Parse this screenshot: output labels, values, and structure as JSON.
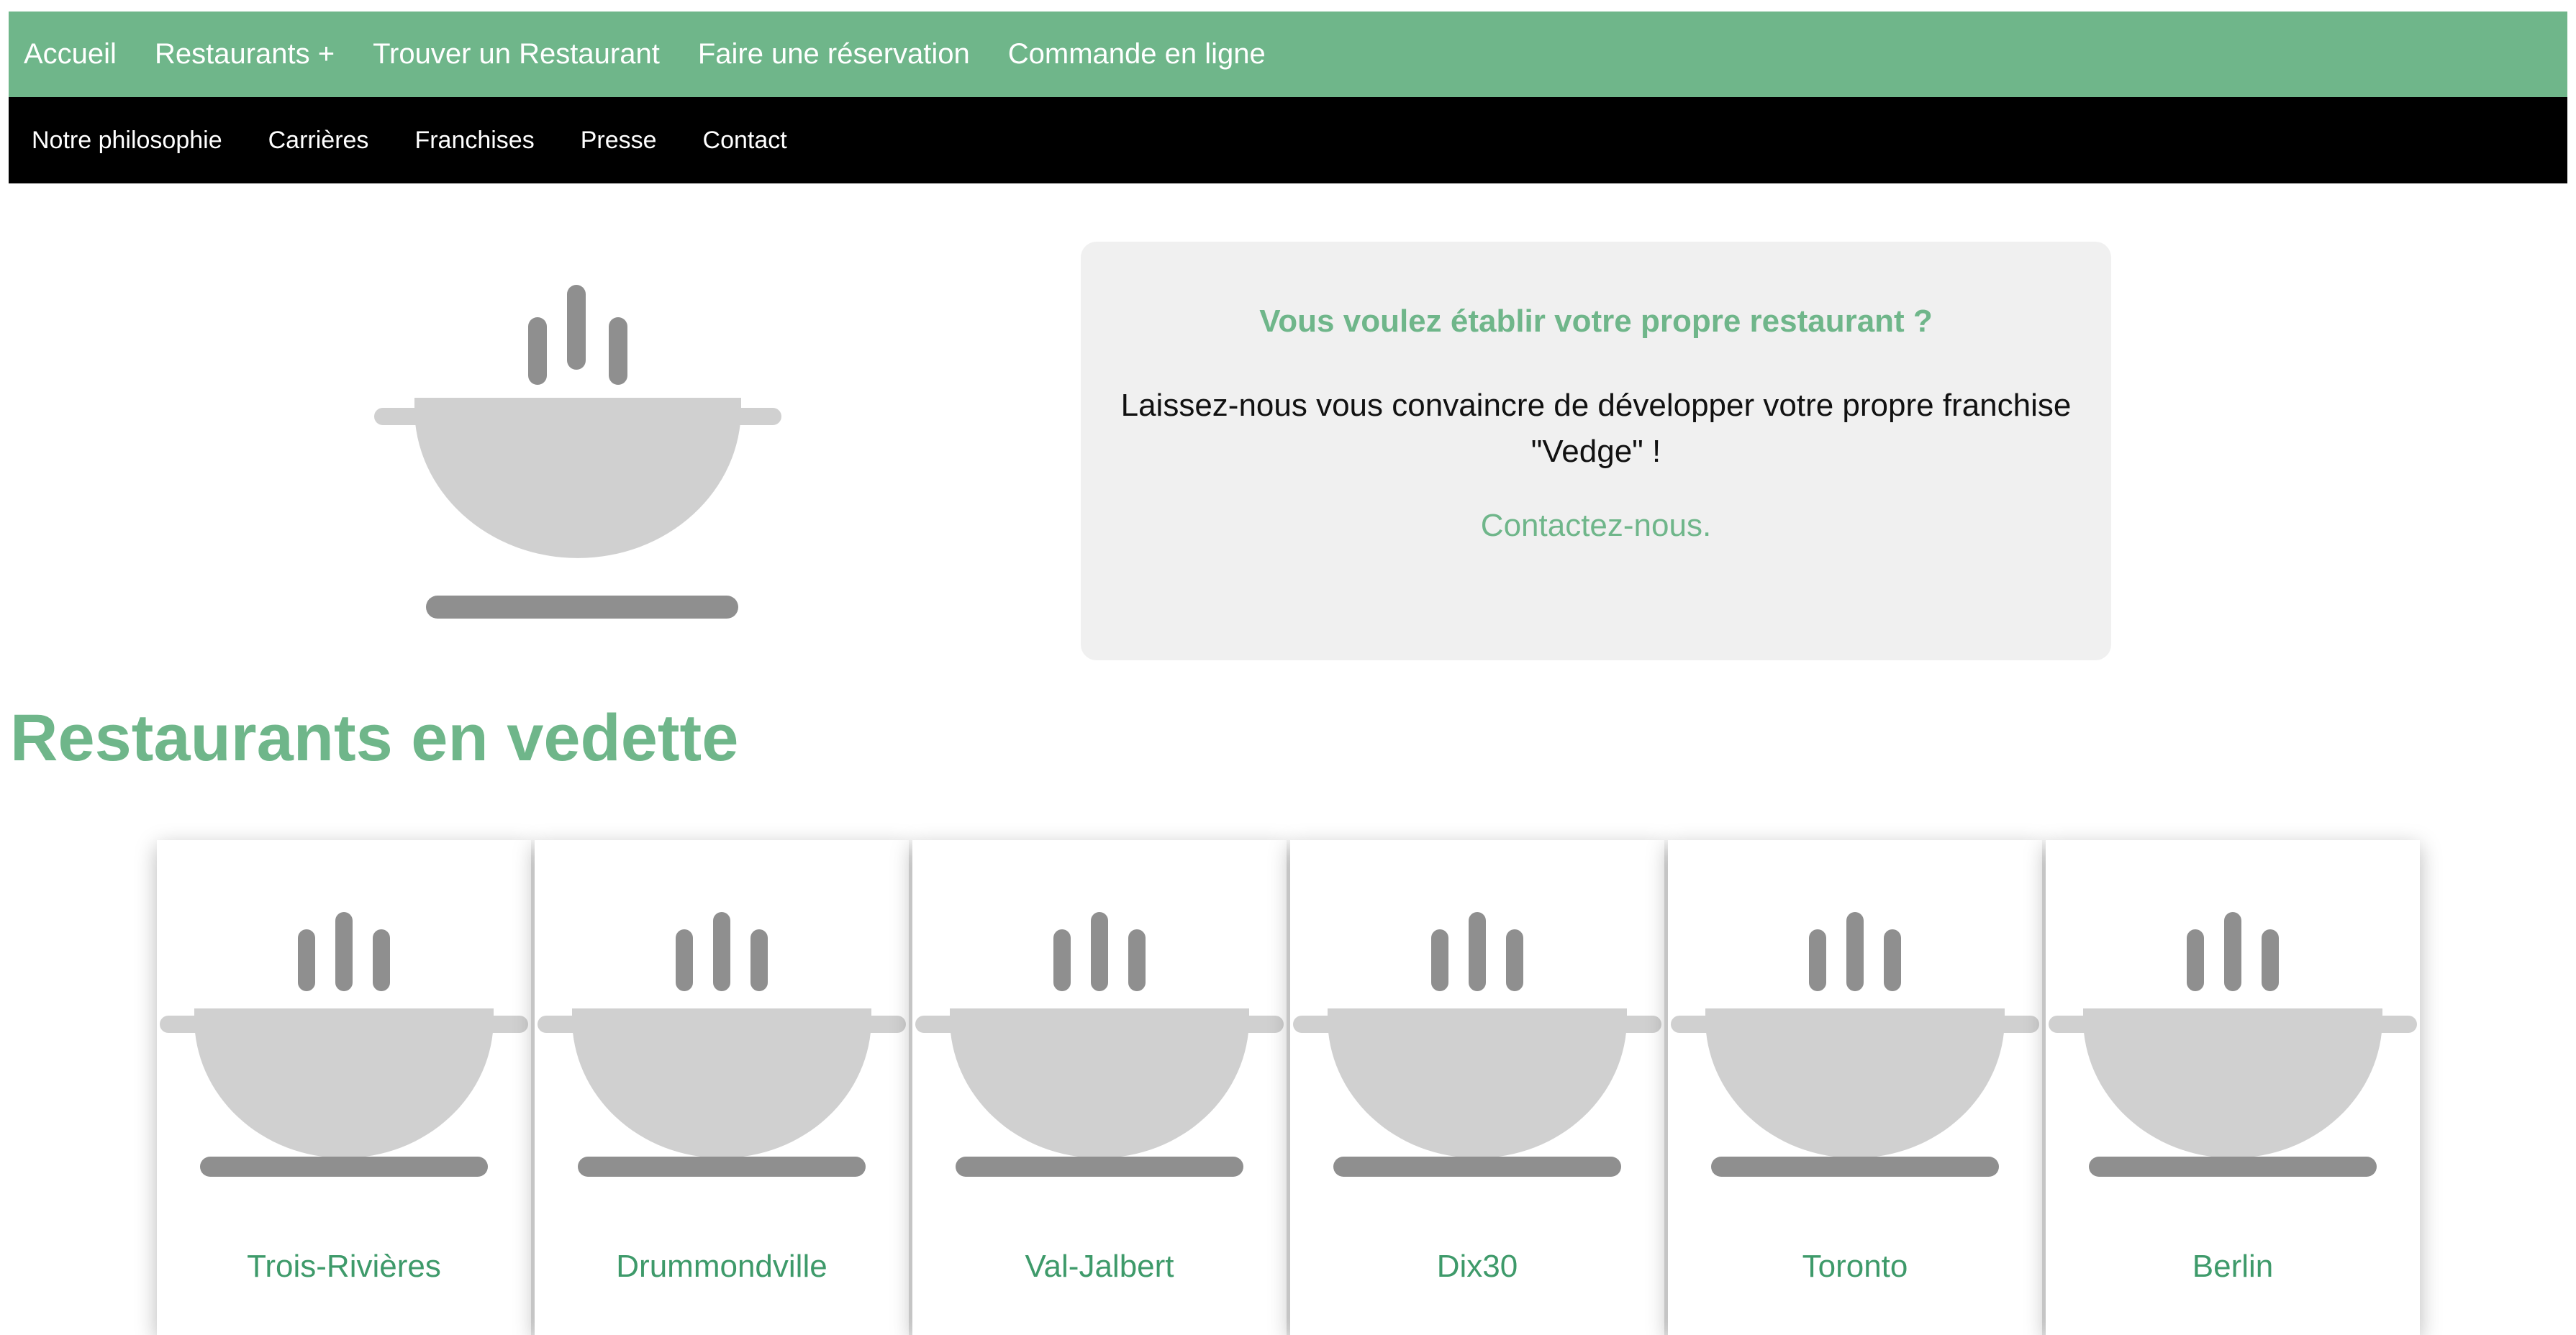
{
  "nav_primary": {
    "items": [
      "Accueil",
      "Restaurants +",
      "Trouver un Restaurant",
      "Faire une réservation",
      "Commande en ligne"
    ]
  },
  "nav_secondary": {
    "items": [
      "Notre philosophie",
      "Carrières",
      "Franchises",
      "Presse",
      "Contact"
    ]
  },
  "hero": {
    "image_icon": "steaming-pot-icon"
  },
  "promo": {
    "title": "Vous voulez établir votre propre restaurant ?",
    "text": "Laissez-nous vous convaincre de développer votre propre franchise \"Vedge\" !",
    "link": "Contactez-nous."
  },
  "featured": {
    "heading": "Restaurants en vedette",
    "restaurants": [
      {
        "name": "Trois-Rivières",
        "icon": "steaming-pot-icon"
      },
      {
        "name": "Drummondville",
        "icon": "steaming-pot-icon"
      },
      {
        "name": "Val-Jalbert",
        "icon": "steaming-pot-icon"
      },
      {
        "name": "Dix30",
        "icon": "steaming-pot-icon"
      },
      {
        "name": "Toronto",
        "icon": "steaming-pot-icon"
      },
      {
        "name": "Berlin",
        "icon": "steaming-pot-icon"
      }
    ]
  },
  "colors": {
    "brand_green": "#6fb68a",
    "link_green": "#3e9a6a",
    "secondary_nav_bg": "#000000",
    "promo_bg": "#f0f0f0",
    "pot_light": "#d0d0d0",
    "pot_dark": "#8f8f8f"
  }
}
